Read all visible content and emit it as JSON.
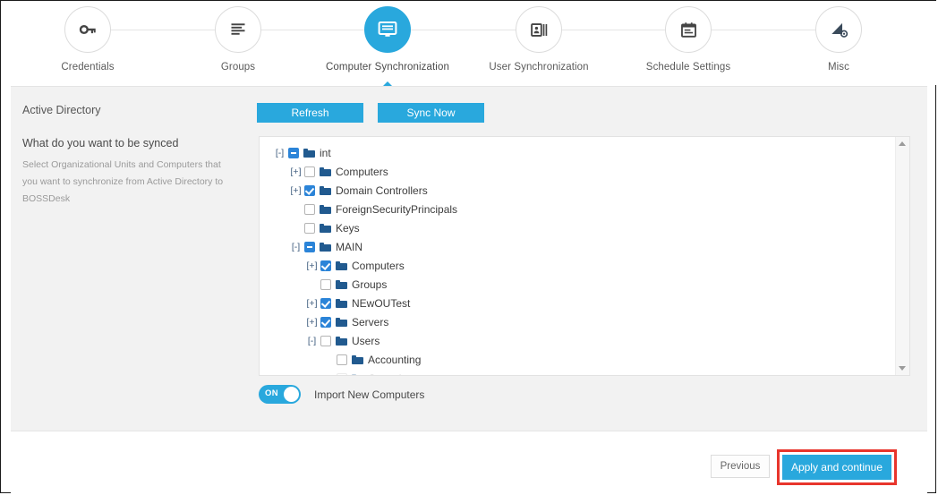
{
  "theme": {
    "accent": "#29a8dd",
    "checkbox_blue": "#2b84d8",
    "folder_blue": "#215a8f",
    "highlight_red": "#e8352c",
    "panel_gray": "#f2f2f2"
  },
  "stepper": {
    "steps": [
      {
        "label": "Credentials",
        "icon": "key-icon",
        "active": false
      },
      {
        "label": "Groups",
        "icon": "list-lines-icon",
        "active": false
      },
      {
        "label": "Computer Synchronization",
        "icon": "monitor-icon",
        "active": true
      },
      {
        "label": "User Synchronization",
        "icon": "id-card-icon",
        "active": false
      },
      {
        "label": "Schedule Settings",
        "icon": "calendar-icon",
        "active": false
      },
      {
        "label": "Misc",
        "icon": "triangle-gear-icon",
        "active": false
      }
    ]
  },
  "left_panel": {
    "title": "Active Directory",
    "subtitle": "What do you want to be synced",
    "description": "Select Organizational Units and Computers that you want to synchronize from Active Directory to BOSSDesk"
  },
  "toolbar": {
    "refresh_label": "Refresh",
    "sync_now_label": "Sync Now"
  },
  "tree": {
    "nodes": [
      {
        "label": "int",
        "depth": 0,
        "toggler": "[-]",
        "check": "indeterminate"
      },
      {
        "label": "Computers",
        "depth": 1,
        "toggler": "[+]",
        "check": "unchecked"
      },
      {
        "label": "Domain Controllers",
        "depth": 1,
        "toggler": "[+]",
        "check": "checked"
      },
      {
        "label": "ForeignSecurityPrincipals",
        "depth": 1,
        "toggler": "",
        "check": "unchecked"
      },
      {
        "label": "Keys",
        "depth": 1,
        "toggler": "",
        "check": "unchecked"
      },
      {
        "label": "MAIN",
        "depth": 1,
        "toggler": "[-]",
        "check": "indeterminate"
      },
      {
        "label": "Computers",
        "depth": 2,
        "toggler": "[+]",
        "check": "checked"
      },
      {
        "label": "Groups",
        "depth": 2,
        "toggler": "",
        "check": "unchecked"
      },
      {
        "label": "NEwOUTest",
        "depth": 2,
        "toggler": "[+]",
        "check": "checked"
      },
      {
        "label": "Servers",
        "depth": 2,
        "toggler": "[+]",
        "check": "checked"
      },
      {
        "label": "Users",
        "depth": 2,
        "toggler": "[-]",
        "check": "unchecked"
      },
      {
        "label": "Accounting",
        "depth": 3,
        "toggler": "",
        "check": "unchecked"
      },
      {
        "label": "Consultant",
        "depth": 3,
        "toggler": "",
        "check": "unchecked",
        "clipped": true
      }
    ]
  },
  "import_toggle": {
    "state_label": "ON",
    "label": "Import New Computers"
  },
  "footer": {
    "previous_label": "Previous",
    "apply_label": "Apply and continue"
  }
}
